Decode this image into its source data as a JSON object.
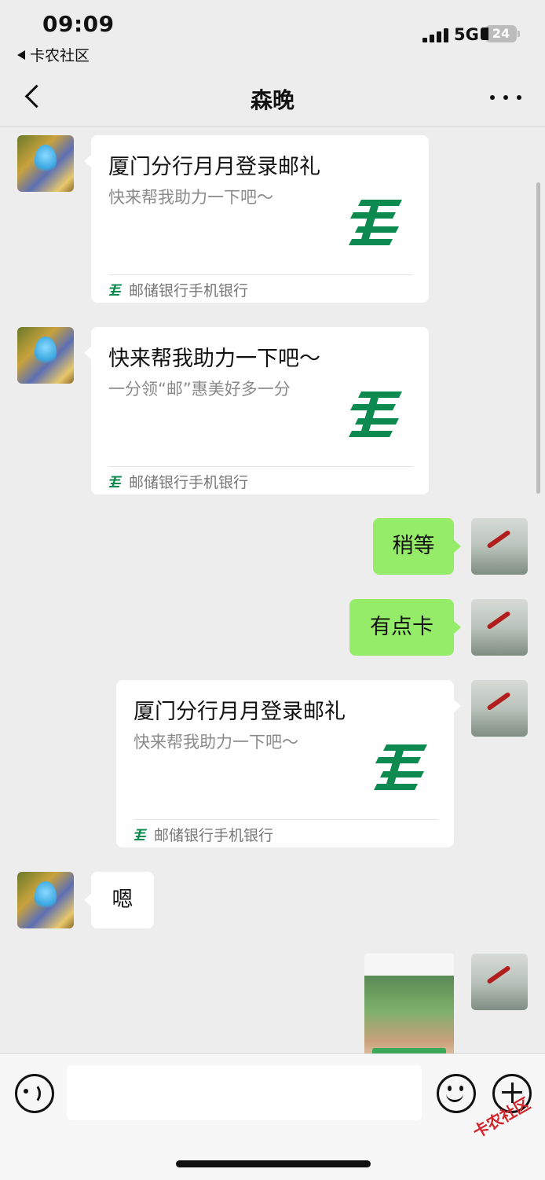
{
  "status_bar": {
    "time": "09:09",
    "back_app": "卡农社区",
    "network": "5G",
    "battery": "24"
  },
  "nav": {
    "title": "森晚"
  },
  "messages": {
    "m1": {
      "title": "厦门分行月月登录邮礼",
      "desc": "快来帮我助力一下吧～",
      "source": "邮储银行手机银行"
    },
    "m2": {
      "title": "快来帮我助力一下吧～",
      "desc": "一分领“邮”惠美好多一分",
      "source": "邮储银行手机银行"
    },
    "m3": {
      "text": "稍等"
    },
    "m4": {
      "text": "有点卡"
    },
    "m5": {
      "title": "厦门分行月月登录邮礼",
      "desc": "快来帮我助力一下吧～",
      "source": "邮储银行手机银行"
    },
    "m6": {
      "text": "嗯"
    }
  },
  "colors": {
    "accent_green": "#95ec69",
    "postal_green": "#0d8a4f",
    "background": "#ededed"
  },
  "watermark": "卡农社区"
}
